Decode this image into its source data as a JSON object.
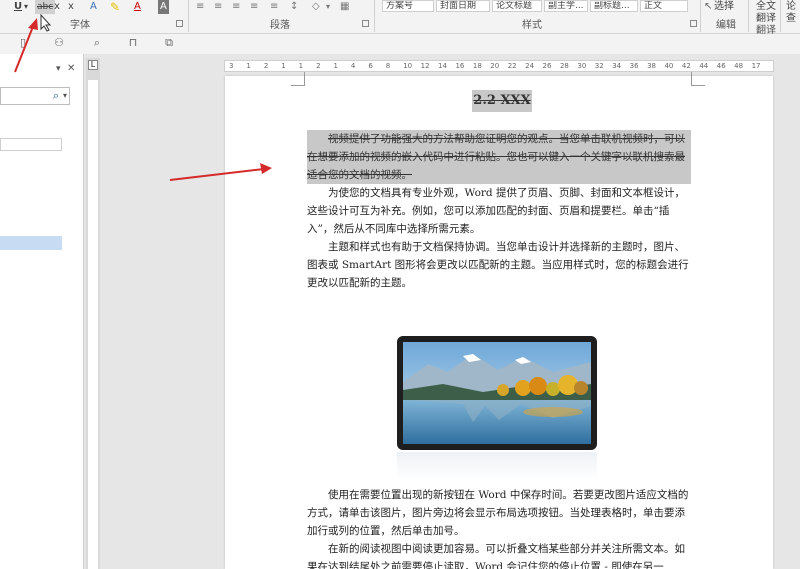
{
  "ribbon": {
    "groups": {
      "font": "字体",
      "paragraph": "段落",
      "styles": "样式",
      "editing": "编辑",
      "translate": "翻译"
    },
    "font_buttons": {
      "underline": "U",
      "strikethrough": "abc",
      "subscript": "x",
      "superscript": "x",
      "text_effects": "A",
      "font_color": "A",
      "char_shading": "A"
    },
    "styles_gallery": [
      "方案号",
      "封面日期",
      "论文标题",
      "副主学...",
      "副标题...",
      "正文"
    ],
    "select_label": "选择",
    "translate_items": [
      "全文",
      "翻译",
      "翻译"
    ],
    "right_cut": "论",
    "right_cut2": "查"
  },
  "navpane": {
    "search_icon": "search-icon"
  },
  "hruler": {
    "ticks": [
      "3",
      "1",
      "2",
      "1",
      "1",
      "2",
      "1",
      "4",
      "6",
      "8",
      "10",
      "12",
      "14",
      "16",
      "18",
      "20",
      "22",
      "24",
      "26",
      "28",
      "30",
      "32",
      "34",
      "36",
      "38",
      "40",
      "42",
      "44",
      "46",
      "48",
      "17"
    ]
  },
  "document": {
    "heading": "2.2 XXX",
    "p1": "视频提供了功能强大的方法帮助您证明您的观点。当您单击联机视频时，可以在想要添加的视频的嵌入代码中进行粘贴。您也可以键入一个关键字以联机搜索最适合您的文档的视频。",
    "p2": "为使您的文档具有专业外观，Word 提供了页眉、页脚、封面和文本框设计，这些设计可互为补充。例如，您可以添加匹配的封面、页眉和提要栏。单击“插入”，然后从不同库中选择所需元素。",
    "p3": "主题和样式也有助于文档保持协调。当您单击设计并选择新的主题时，图片、图表或 SmartArt 图形将会更改以匹配新的主题。当应用样式时，您的标题会进行更改以匹配新的主题。",
    "p4": "使用在需要位置出现的新按钮在 Word 中保存时间。若要更改图片适应文档的方式，请单击该图片，图片旁边将会显示布局选项按钮。当处理表格时，单击要添加行或列的位置，然后单击加号。",
    "p5": "在新的阅读视图中阅读更加容易。可以折叠文档某些部分并关注所需文本。如果在达到结尾处之前需要停止读取，Word 会记住您的停止位置 - 即使在另一"
  },
  "colors": {
    "arrow": "#d42a2a",
    "selection": "#c8c8c8",
    "nav_highlight": "#c7dcf3"
  }
}
